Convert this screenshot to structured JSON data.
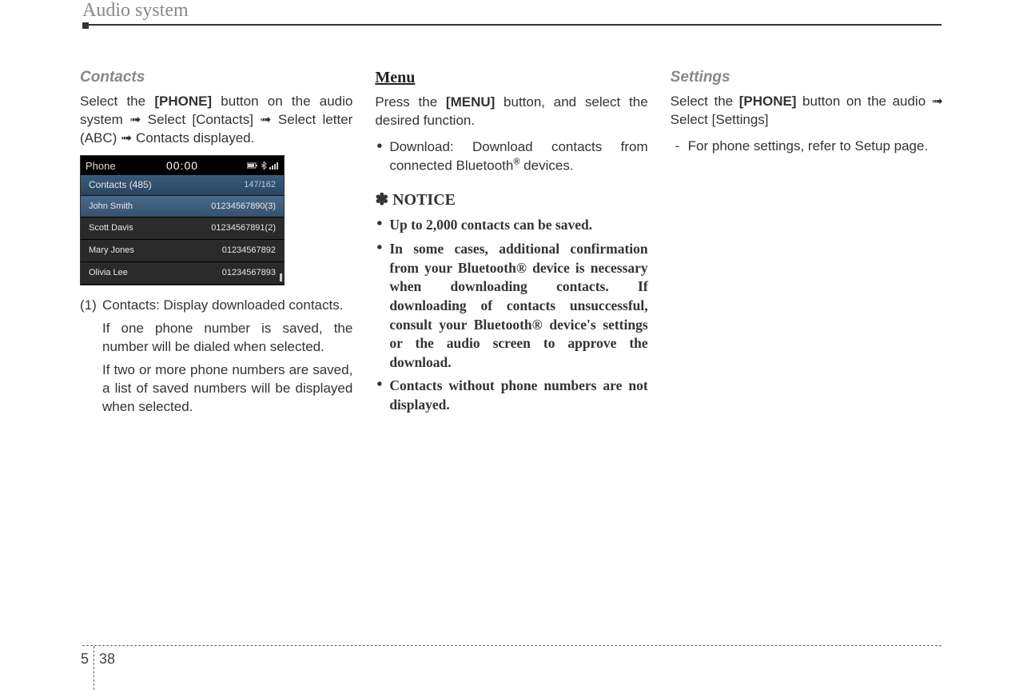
{
  "header": {
    "chapter_title": "Audio system"
  },
  "footer": {
    "section": "5",
    "page": "38"
  },
  "col1": {
    "heading": "Contacts",
    "intro_parts": {
      "p1": "Select the ",
      "b1": "[PHONE]",
      "p2": " button on the audio system ➟ Select [Contacts] ➟ Select letter (ABC) ➟ Contacts displayed."
    },
    "item1_label": "(1)",
    "item1_text": "Contacts: Display downloaded contacts.",
    "item1_sub1": "If one phone number is saved, the number will be dialed when selected.",
    "item1_sub2": "If two or more phone numbers are saved, a list of saved numbers will be displayed when selected."
  },
  "phone_screen": {
    "topbar": {
      "title": "Phone",
      "clock": "00:00"
    },
    "contacts_label": "Contacts (485)",
    "page_indicator": "147/162",
    "rows": [
      {
        "name": "John Smith",
        "number": "01234567890(3)",
        "selected": true
      },
      {
        "name": "Scott Davis",
        "number": "01234567891(2)",
        "selected": false
      },
      {
        "name": "Mary Jones",
        "number": "01234567892",
        "selected": false
      },
      {
        "name": "Olivia Lee",
        "number": "01234567893",
        "selected": false
      }
    ]
  },
  "col2": {
    "heading": "Menu",
    "intro_parts": {
      "p1": "Press the ",
      "b1": "[MENU]",
      "p2": " button, and select the desired function."
    },
    "bullet1_parts": {
      "p1": "Download: Download contacts from connected Bluetooth",
      "sup": "®",
      "p2": " devices."
    },
    "notice_heading": "✽ NOTICE",
    "notice_b1": "Up to 2,000 contacts can be saved.",
    "notice_b2": "In some cases, additional confirmation from your Bluetooth® device is necessary when downloading contacts. If downloading of contacts unsuccessful, consult your Bluetooth® device's settings or the audio screen to approve the download.",
    "notice_b3": "Contacts without phone numbers are not displayed."
  },
  "col3": {
    "heading": "Settings",
    "intro_parts": {
      "p1": "Select the ",
      "b1": "[PHONE]",
      "p2": " button on the audio ➟ Select [Settings]"
    },
    "dash1": "For phone settings, refer to Setup page."
  }
}
